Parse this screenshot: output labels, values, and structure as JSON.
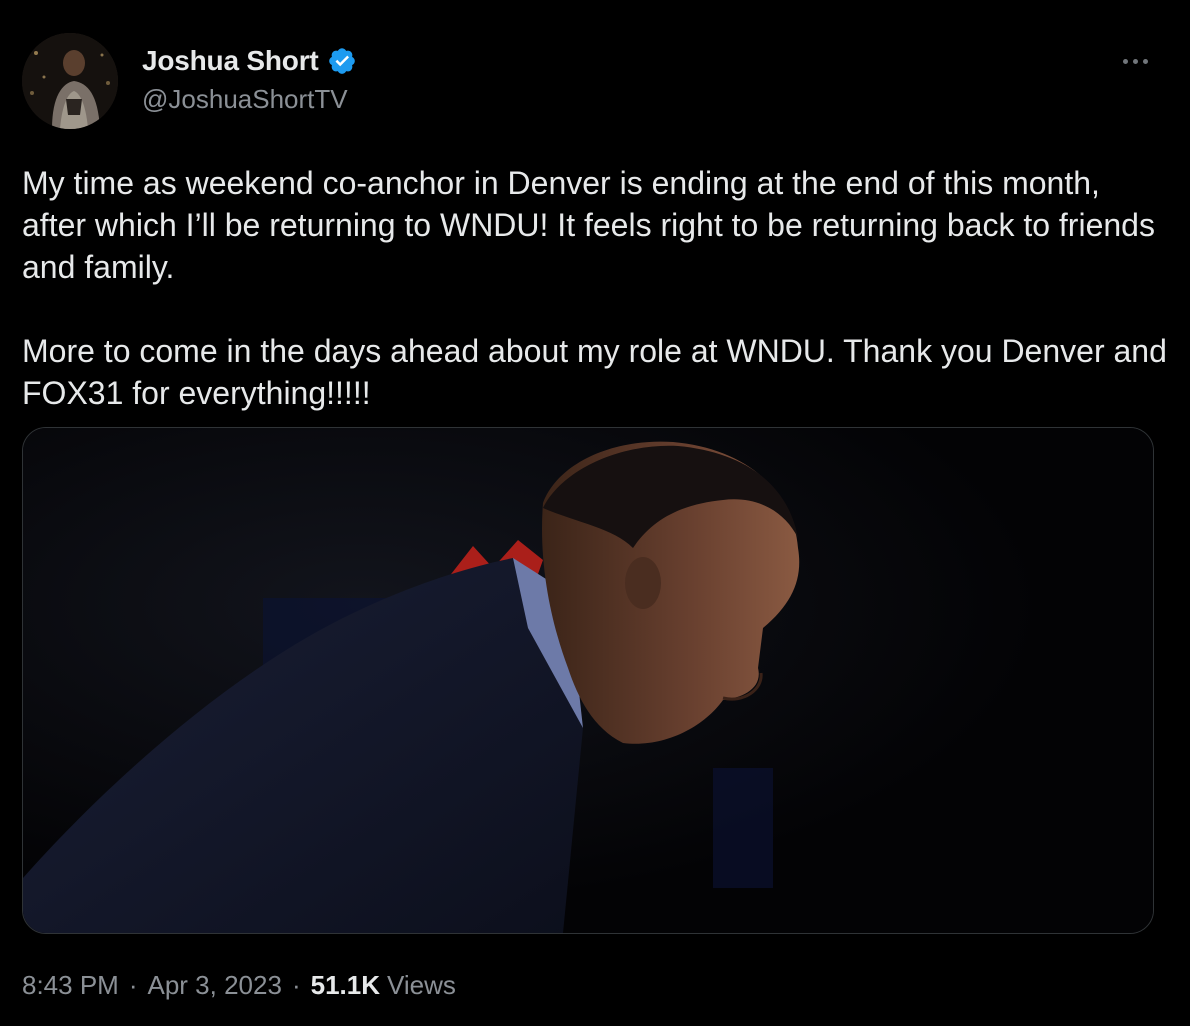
{
  "author": {
    "display_name": "Joshua Short",
    "handle": "@JoshuaShortTV",
    "verified": true
  },
  "tweet": {
    "text": "My time as weekend co-anchor in Denver is ending at the end of this month, after which I’ll be returning to WNDU! It feels right to be returning back to friends and family.\n\nMore to come in the days ahead about my role at WNDU. Thank you Denver and FOX31 for everything!!!!!",
    "time": "8:43 PM",
    "date": "Apr 3, 2023",
    "separator": "·",
    "views_count": "51.1K",
    "views_label": "Views"
  },
  "icons": {
    "verified": "verified-badge-icon",
    "more": "more-options-icon"
  },
  "colors": {
    "background": "#000000",
    "primary_text": "#e7e9ea",
    "secondary_text": "#8b9096",
    "verified_blue": "#1d9bf0",
    "media_border": "#2f3336"
  }
}
